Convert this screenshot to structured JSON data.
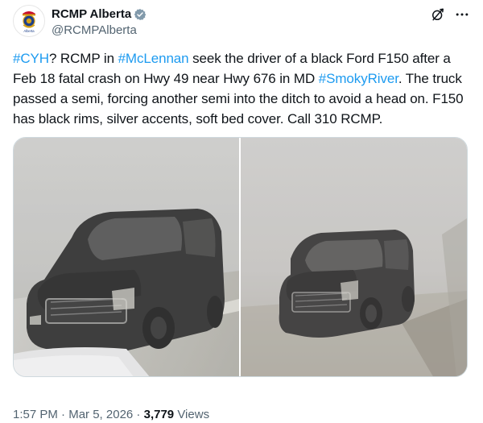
{
  "account": {
    "display_name": "RCMP Alberta",
    "handle": "@RCMPAlberta",
    "verified": true,
    "avatar_text": "Alberta"
  },
  "post": {
    "segments": [
      {
        "text": "#CYH",
        "type": "hashtag"
      },
      {
        "text": "? RCMP in ",
        "type": "text"
      },
      {
        "text": "#McLennan",
        "type": "hashtag"
      },
      {
        "text": " seek the driver of a black Ford F150 after a Feb 18 fatal crash on Hwy 49 near Hwy 676 in MD ",
        "type": "text"
      },
      {
        "text": "#SmokyRiver",
        "type": "hashtag"
      },
      {
        "text": ". The truck passed a semi, forcing another semi into the ditch to avoid a head on. F150 has black rims, silver accents, soft bed cover. Call 310 RCMP.",
        "type": "text"
      }
    ]
  },
  "media": {
    "photos": [
      "truck-photo-front-close",
      "truck-photo-front-far"
    ]
  },
  "footer": {
    "time": "1:57 PM",
    "separator": " · ",
    "date": "Mar 5, 2026",
    "views_count": "3,779",
    "views_label": " Views"
  },
  "colors": {
    "hashtag": "#1d9bf0",
    "secondary_text": "#536471",
    "verified_badge": "#829aab"
  },
  "icons": {
    "verified": "verified-badge-icon",
    "grok": "grok-icon",
    "more": "more-options-icon"
  }
}
